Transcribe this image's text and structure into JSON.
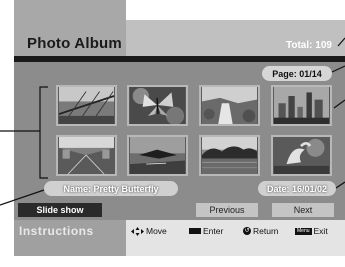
{
  "header": {
    "title": "Photo Album",
    "total": "Total: 109"
  },
  "page_indicator": "Page: 01/14",
  "thumbnails": [
    {
      "icon": "bridge-photo-icon"
    },
    {
      "icon": "butterfly-photo-icon"
    },
    {
      "icon": "waterfall-photo-icon"
    },
    {
      "icon": "city-skyline-photo-icon"
    },
    {
      "icon": "station-photo-icon"
    },
    {
      "icon": "bird-photo-icon"
    },
    {
      "icon": "lake-photo-icon"
    },
    {
      "icon": "swan-photo-icon"
    }
  ],
  "selection": {
    "name": "Name: Pretty Butterfly",
    "date": "Date: 16/01/02"
  },
  "buttons": {
    "slide_show": "Slide show",
    "previous": "Previous",
    "next": "Next"
  },
  "instructions": {
    "label": "Instructions",
    "move": "Move",
    "enter": "Enter",
    "return": "Return",
    "menu_key": "Menu",
    "exit": "Exit"
  }
}
